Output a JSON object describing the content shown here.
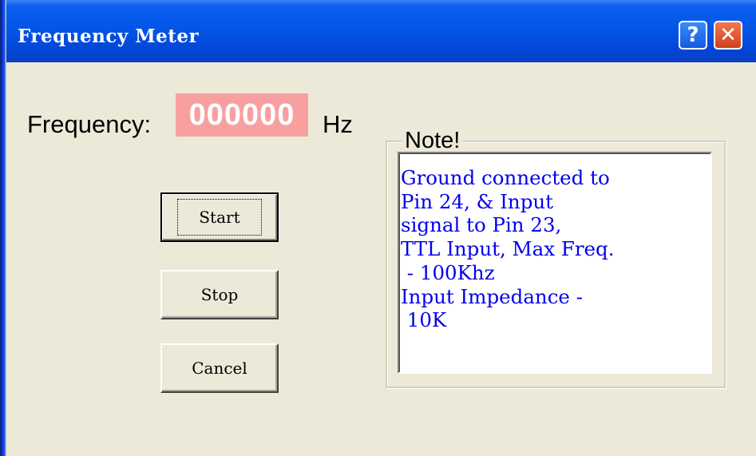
{
  "window": {
    "title": "Frequency Meter",
    "help_glyph": "?",
    "close_glyph": "✕"
  },
  "frequency": {
    "label": "Frequency:",
    "value": "000000",
    "unit": "Hz",
    "value_bg_color": "#f8a0a0"
  },
  "buttons": {
    "start": "Start",
    "stop": "Stop",
    "cancel": "Cancel"
  },
  "note": {
    "title": "Note!",
    "text": "Ground connected to\nPin 24, & Input\nsignal to Pin 23,\nTTL Input, Max Freq.\n - 100Khz\nInput Impedance -\n 10K",
    "text_color": "#0000ee"
  },
  "colors": {
    "titlebar": "#0458e8",
    "dialog_bg": "#ece9d8"
  }
}
